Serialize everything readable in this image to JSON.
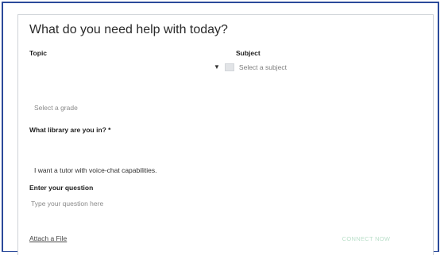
{
  "form": {
    "title": "What do you need help with today?",
    "topic_label": "Topic",
    "subject_label": "Subject",
    "subject_caret": "▼",
    "subject_placeholder": "Select a subject",
    "grade_placeholder": "Select a grade",
    "library_label": "What library are you in? *",
    "voice_chat_label": "I want a tutor with voice-chat capabilities.",
    "question_label": "Enter your question",
    "question_placeholder": "Type your question here",
    "attach_label": "Attach a File",
    "connect_label": "CONNECT NOW"
  },
  "colors": {
    "frame_border": "#2b4a9a",
    "connect_text": "#b9dfc9"
  }
}
